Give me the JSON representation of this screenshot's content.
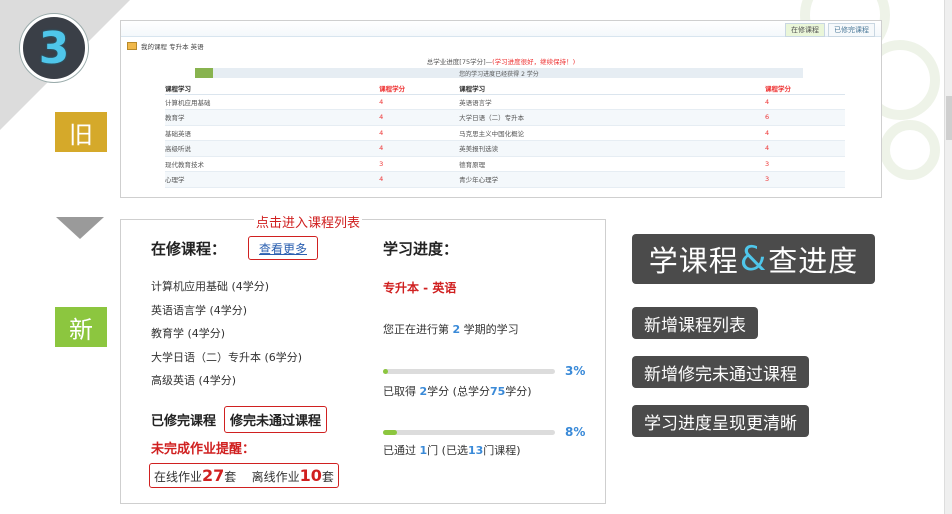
{
  "step_number": "3",
  "tags": {
    "old": "旧",
    "new": "新"
  },
  "old_screen": {
    "tabs": [
      "在修课程",
      "已修完课程"
    ],
    "breadcrumb": "我的课程 专升本 英语",
    "summary_prefix": "总学业进度[75学分]—",
    "summary_highlight": "(学习进度很好，继续保持！)",
    "progress_text": "您的学习进度已经获得 2 学分",
    "progress_fraction": 0.03,
    "columns": [
      "课程学习",
      "课程学分",
      "课程学习",
      "课程学分"
    ],
    "rows": [
      [
        "计算机应用基础",
        "4",
        "英语语言学",
        "4"
      ],
      [
        "教育学",
        "4",
        "大学日语（二）专升本",
        "6"
      ],
      [
        "基础英语",
        "4",
        "马克思主义中国化概论",
        "4"
      ],
      [
        "高级听说",
        "4",
        "英美报刊选读",
        "4"
      ],
      [
        "现代教育技术",
        "3",
        "德育原理",
        "3"
      ],
      [
        "心理学",
        "4",
        "青少年心理学",
        "3"
      ]
    ]
  },
  "new_screen": {
    "callout": "点击进入课程列表",
    "current_courses_title": "在修课程：",
    "see_more": "查看更多",
    "courses": [
      "计算机应用基础 (4学分)",
      "英语语言学 (4学分)",
      "教育学 (4学分)",
      "大学日语（二）专升本 (6学分)",
      "高级英语 (4学分)"
    ],
    "completed_label": "已修完课程",
    "unfinished_label": "修完未通过课程",
    "homework_title": "未完成作业提醒：",
    "homework": {
      "online_label": "在线作业",
      "online_count": "27",
      "online_unit": "套",
      "offline_label": "离线作业",
      "offline_count": "10",
      "offline_unit": "套"
    },
    "progress_title": "学习进度：",
    "major": "专升本 - 英语",
    "term": {
      "prefix": "您正在进行第",
      "number": "2",
      "suffix": "学期的学习"
    },
    "credits": {
      "percent_label": "3%",
      "percent": 3,
      "prefix": "已取得",
      "earned": "2",
      "middle": "学分 (总学分",
      "total": "75",
      "suffix": "学分)"
    },
    "courses_passed": {
      "percent_label": "8%",
      "percent": 8,
      "prefix": "已通过",
      "passed": "1",
      "middle": "门 (已选",
      "selected": "13",
      "suffix": "门课程)"
    }
  },
  "features": {
    "headline_left": "学课程",
    "headline_amp": "&",
    "headline_right": "查进度",
    "items": [
      "新增课程列表",
      "新增修完未通过课程",
      "学习进度呈现更清晰"
    ]
  },
  "colors": {
    "accent_blue": "#4fc6ea",
    "highlight_red": "#d02020",
    "old_tag": "#d5a92a",
    "new_tag": "#8cc63f",
    "pill_bg": "#4b4b4b"
  }
}
